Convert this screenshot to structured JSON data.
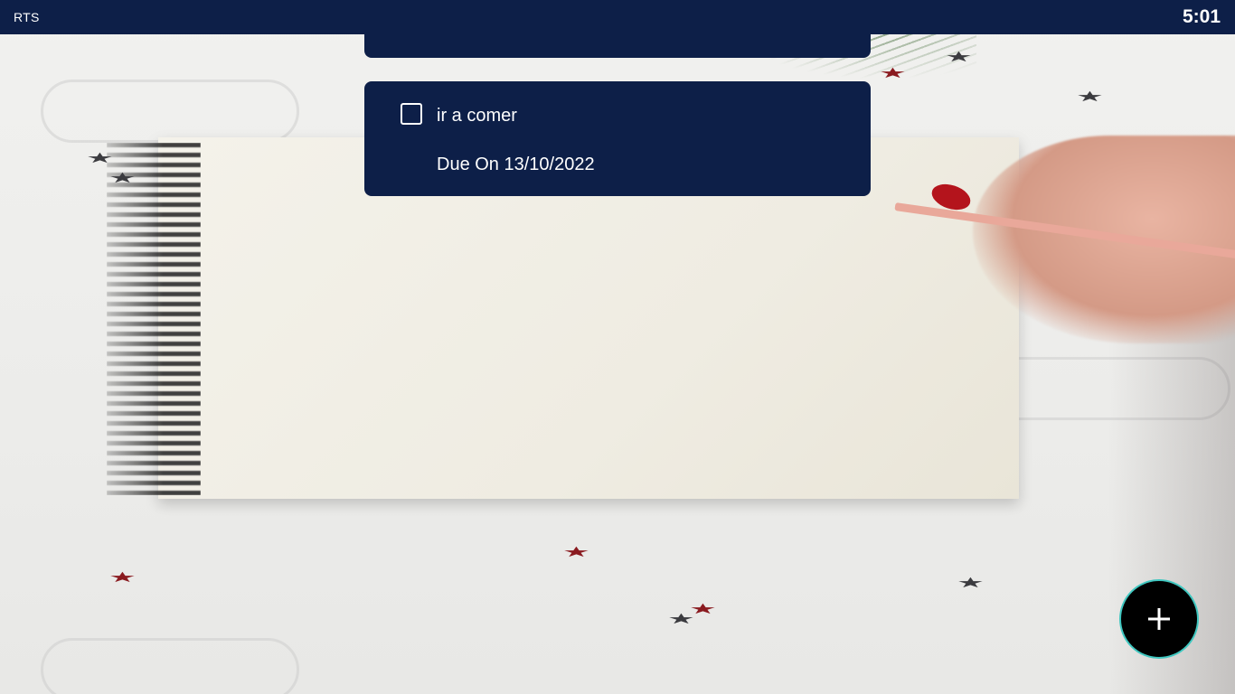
{
  "status_bar": {
    "app_name": "RTS",
    "time": "5:01"
  },
  "tasks": [
    {
      "title": "ir a comer",
      "due": "Due On 13/10/2022",
      "checked": false
    }
  ],
  "fab": {
    "icon": "plus-icon"
  },
  "colors": {
    "bar_background": "#0d1f48",
    "card_background": "#0d1f48",
    "text": "#ffffff",
    "fab_background": "#000000",
    "fab_border": "#3fc7c0",
    "star_red": "#8a1a1f",
    "star_dark": "#3b3b3f"
  }
}
